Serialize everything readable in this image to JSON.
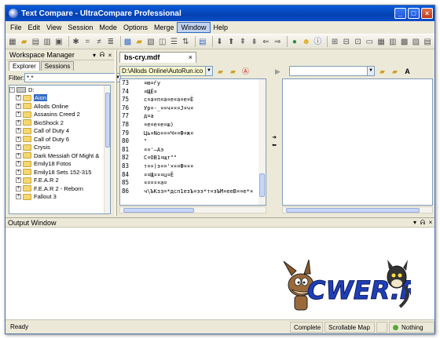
{
  "window": {
    "title": "Text Compare - UltraCompare Professional"
  },
  "menu": [
    "File",
    "Edit",
    "View",
    "Session",
    "Mode",
    "Options",
    "Merge",
    "Window",
    "Help"
  ],
  "active_menu": "Window",
  "workspace": {
    "title": "Workspace Manager",
    "tabs": [
      "Explorer",
      "Sessions"
    ],
    "filter_label": "Filter:",
    "filter_value": "*.*",
    "drive": "D:",
    "folders": [
      "Aion",
      "Allods Online",
      "Assasins Creed 2",
      "BioShock 2",
      "Call of Duty 4",
      "Call of Duty 6",
      "Crysis",
      "Dark Messiah Of Might &",
      "Emily18 Fotos",
      "Emily18 Sets 152-315",
      "F.E.A.R 2",
      "F.E.A.R 2 - Reborn",
      "Fallout 3"
    ],
    "selected": "Aion"
  },
  "document": {
    "tab_label": "bs-cry.mdf",
    "left_path": "D:\\Allods Online\\AutoRun.ico",
    "right_path": "",
    "line_numbers": [
      "73",
      "74",
      "75",
      "76",
      "77",
      "78",
      "79",
      "80",
      "81",
      "82",
      "83",
      "84",
      "85",
      "86"
    ],
    "lines": [
      "¤ю¤ѓу",
      "¤ЩЁ¤",
      "с¤а¤п¤а¤е¤а¤е¤Ё",
      "Ур¤-_¤¤ч¤¤¤Ј¤ч¤",
      "д¤а",
      "¤е¤е¤е¤ш)",
      "Ць¤No¤¤¤Ч¤¤Ф¤ж¤",
      "\"",
      "¤¤'—Аэ",
      "С¤ОВ1¤щт\"\"",
      "т¤¤)э¤¤'¤¤¤Ф¤¤¤",
      "¤¤Щ¤¤¤ц¤Ё",
      "¤¤¤¤¤а¤",
      "ч\\ЪКзз=*дсп1езЪ¤ээ*т¤эЪМ¤ееВ¤¤е*¤"
    ]
  },
  "output": {
    "title": "Output Window",
    "logo_text": "CWER.RU"
  },
  "status": {
    "left": "Ready",
    "compare": "Complete",
    "map": "Scrollable Map",
    "result": "Nothing"
  },
  "colors": {
    "title_bar": "#0441b0",
    "selection": "#316ac5",
    "path_bg": "#fafad0",
    "logo_blue": "#1f3fb6"
  }
}
